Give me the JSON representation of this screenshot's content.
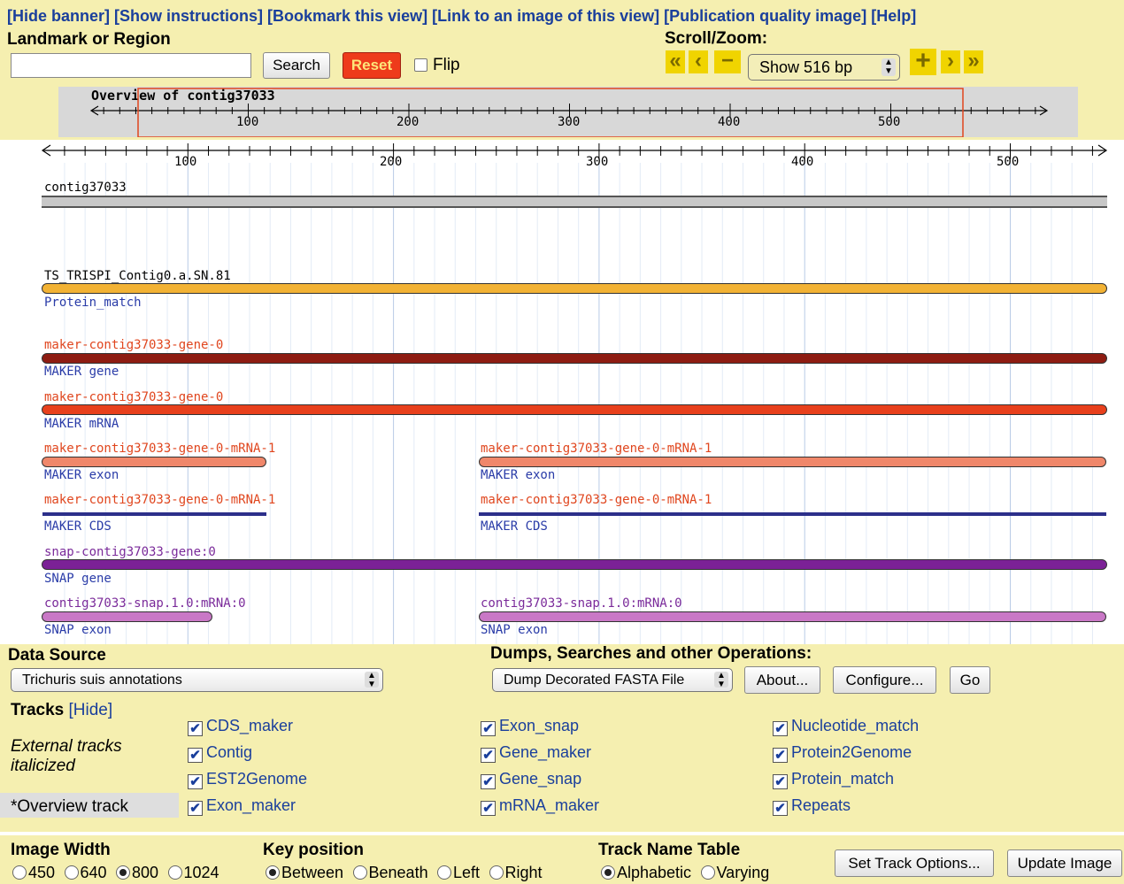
{
  "banner": {
    "links": [
      "[Hide banner]",
      "[Show instructions]",
      "[Bookmark this view]",
      "[Link to an image of this view]",
      "[Publication quality image]",
      "[Help]"
    ]
  },
  "landmark": {
    "label": "Landmark or Region",
    "value": "",
    "search_label": "Search",
    "reset_label": "Reset",
    "flip_label": "Flip"
  },
  "scroll_zoom": {
    "label": "Scroll/Zoom:",
    "left_far": "«",
    "left": "‹",
    "zoom_out": "−",
    "show_value": "Show 516 bp",
    "zoom_in": "+",
    "right": "›",
    "right_far": "»"
  },
  "overview": {
    "title": "Overview of contig37033",
    "ticks": [
      "100",
      "200",
      "300",
      "400",
      "500"
    ]
  },
  "ruler": {
    "ticks": [
      "100",
      "200",
      "300",
      "400",
      "500"
    ]
  },
  "tracks": {
    "contig_name": "contig37033",
    "protein_name": "TS_TRISPI_Contig0.a.SN.81",
    "protein_type": "Protein_match",
    "gene_name": "maker-contig37033-gene-0",
    "gene_type": "MAKER gene",
    "mrna_name": "maker-contig37033-gene-0",
    "mrna_type": "MAKER mRNA",
    "exon_name_1": "maker-contig37033-gene-0-mRNA-1",
    "exon_name_2": "maker-contig37033-gene-0-mRNA-1",
    "exon_type_1": "MAKER exon",
    "exon_type_2": "MAKER exon",
    "cds_name_1": "maker-contig37033-gene-0-mRNA-1",
    "cds_name_2": "maker-contig37033-gene-0-mRNA-1",
    "cds_type_1": "MAKER CDS",
    "cds_type_2": "MAKER CDS",
    "snap_gene_name": "snap-contig37033-gene:0",
    "snap_gene_type": "SNAP gene",
    "snap_exon_name_1": "contig37033-snap.1.0:mRNA:0",
    "snap_exon_name_2": "contig37033-snap.1.0:mRNA:0",
    "snap_exon_type_1": "SNAP exon",
    "snap_exon_type_2": "SNAP exon"
  },
  "data_source": {
    "label": "Data Source",
    "selected": "Trichuris suis annotations"
  },
  "dumps": {
    "label": "Dumps, Searches and other Operations:",
    "selected": "Dump Decorated FASTA File",
    "about_label": "About...",
    "configure_label": "Configure...",
    "go_label": "Go"
  },
  "track_list": {
    "title": "Tracks",
    "hide_link": "[Hide]",
    "note": "External tracks italicized",
    "overview_note": "*Overview track",
    "items": [
      "CDS_maker",
      "Contig",
      "EST2Genome",
      "Exon_maker",
      "Exon_snap",
      "Gene_maker",
      "Gene_snap",
      "mRNA_maker",
      "Nucleotide_match",
      "Protein2Genome",
      "Protein_match",
      "Repeats"
    ]
  },
  "image_width": {
    "label": "Image Width",
    "options": [
      "450",
      "640",
      "800",
      "1024"
    ],
    "selected": "800"
  },
  "key_position": {
    "label": "Key position",
    "options": [
      "Between",
      "Beneath",
      "Left",
      "Right"
    ],
    "selected": "Between"
  },
  "track_name_table": {
    "label": "Track Name Table",
    "options": [
      "Alphabetic",
      "Varying"
    ],
    "selected": "Alphabetic"
  },
  "actions": {
    "set_track_options": "Set Track Options...",
    "update_image": "Update Image"
  },
  "colors": {
    "banner_bg": "#f5efb0",
    "link_blue": "#1a3f9c",
    "protein_match": "#f2b234",
    "maker_gene": "#8e1c12",
    "maker_mrna": "#e8401c",
    "maker_exon": "#f0876a",
    "maker_cds": "#2c2f8a",
    "snap_gene": "#7b2196",
    "snap_exon": "#c978c6"
  }
}
